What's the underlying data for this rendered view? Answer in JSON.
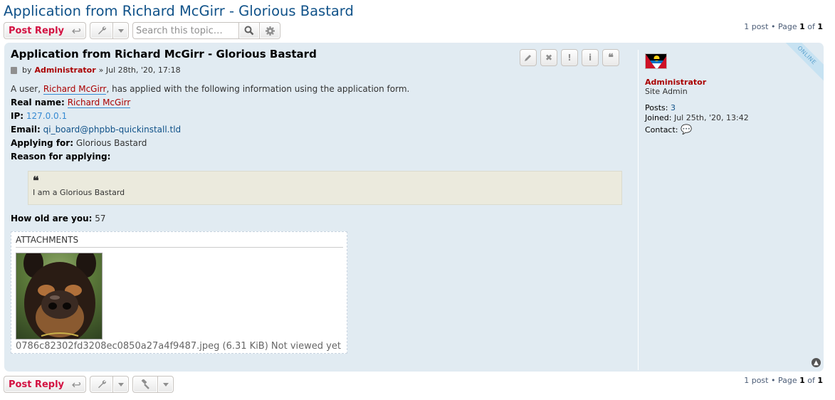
{
  "topic": {
    "title": "Application from Richard McGirr - Glorious Bastard"
  },
  "actions": {
    "post_reply_label": "Post Reply",
    "search_placeholder": "Search this topic…"
  },
  "pagination": {
    "count_text": "1 post • Page ",
    "current_page": "1",
    "of_text": " of ",
    "total_pages": "1"
  },
  "post": {
    "status": "ONLINE",
    "title": "Application from Richard McGirr - Glorious Bastard",
    "meta_by": "by",
    "author": "Administrator",
    "date": "» Jul 28th, '20, 17:18",
    "intro_prefix": "A user, ",
    "intro_user": "Richard McGirr",
    "intro_suffix": ", has applied with the following information using the application form.",
    "fields": {
      "real_name_label": "Real name:",
      "real_name_value": "Richard McGirr",
      "ip_label": "IP:",
      "ip_value": "127.0.0.1",
      "email_label": "Email:",
      "email_value": "qi_board@phpbb-quickinstall.tld",
      "applying_label": "Applying for:",
      "applying_value": "Glorious Bastard",
      "reason_label": "Reason for applying:",
      "age_label": "How old are you:",
      "age_value": "57"
    },
    "quote": {
      "icon": "❝",
      "text": "I am a Glorious Bastard"
    },
    "attachments": {
      "title": "ATTACHMENTS",
      "filename": "0786c82302fd3208ec0850a27a4f9487.jpeg (6.31 KiB) Not viewed yet"
    }
  },
  "profile": {
    "username": "Administrator",
    "rank": "Site Admin",
    "posts_label": "Posts:",
    "posts_value": "3",
    "joined_label": "Joined:",
    "joined_value": "Jul 25th, '20, 13:42",
    "contact_label": "Contact:"
  },
  "colors": {
    "post_bg": "#e1ebf2",
    "title_blue": "#105289",
    "author_red": "#aa0000",
    "reply_red": "#d31141",
    "quote_bg": "#ebeadd"
  },
  "icons": {
    "reply": "reply-icon",
    "wrench": "wrench-icon",
    "caret": "caret-down-icon",
    "search": "search-icon",
    "gear": "gear-icon",
    "hammer": "hammer-icon",
    "edit": "pencil-icon",
    "delete": "close-icon",
    "report": "exclamation-icon",
    "info": "info-icon",
    "quote": "quote-icon",
    "contact": "chat-bubble-icon",
    "top": "chevron-up-icon"
  }
}
